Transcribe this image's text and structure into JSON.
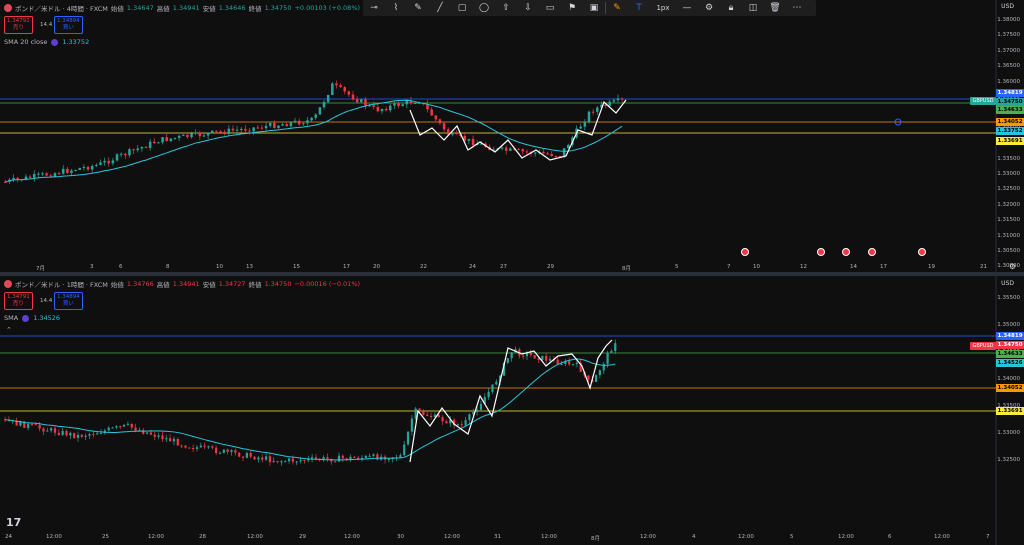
{
  "toolbar": {
    "icons": [
      "horizontal-ray-icon",
      "path-icon",
      "pen-icon",
      "line-icon",
      "rectangle-icon",
      "circle-icon",
      "arrow-up-icon",
      "arrow-down-icon",
      "note-icon",
      "flag-icon",
      "image-icon",
      "palette-icon",
      "text-color-icon",
      "line-width-icon",
      "line-style-icon",
      "settings-icon",
      "lock-icon",
      "hide-icon",
      "trash-icon",
      "more-icon"
    ],
    "width_label": "1px"
  },
  "pane1": {
    "title": "ポンド／米ドル · 4時間 · FXCM",
    "open_label": "始値",
    "open": "1.34647",
    "high_label": "高値",
    "high": "1.34941",
    "low_label": "安値",
    "low": "1.34646",
    "close_label": "終値",
    "close": "1.34750",
    "change": "+0.00103 (+0.08%)",
    "sell_price": "1.34791",
    "sell_label": "売り",
    "buy_price": "1.34894",
    "buy_label": "買い",
    "spread": "14.4",
    "sma_label": "SMA 20 close",
    "sma_value": "1.33752",
    "currency": "USD",
    "y_ticks": [
      "1.38000",
      "1.37500",
      "1.37000",
      "1.36500",
      "1.36000",
      "1.35500",
      "1.35000",
      "1.34500",
      "1.34000",
      "1.33500",
      "1.33000",
      "1.32500",
      "1.32000",
      "1.31500",
      "1.31000",
      "1.30500",
      "1.30000",
      "1.29500"
    ],
    "price_tags": [
      {
        "text": "1.34819",
        "color": "#2962ff"
      },
      {
        "text": "1.34750",
        "color": "#26a69a"
      },
      {
        "text": "1.34633",
        "color": "#4caf50"
      },
      {
        "text": "1.34052",
        "color": "#ff9800"
      },
      {
        "text": "1.33752",
        "color": "#26c6da"
      },
      {
        "text": "1.33691",
        "color": "#ffeb3b"
      }
    ],
    "pair_tag": "GBPUSD",
    "x_labels": [
      "7月",
      "3",
      "6",
      "8",
      "10",
      "13",
      "15",
      "17",
      "20",
      "22",
      "24",
      "27",
      "29",
      "8月",
      "5",
      "7",
      "10",
      "12",
      "14",
      "17",
      "19",
      "21"
    ]
  },
  "pane2": {
    "title": "ポンド／米ドル · 1時間 · FXCM",
    "open_label": "始値",
    "open": "1.34766",
    "high_label": "高値",
    "high": "1.34941",
    "low_label": "安値",
    "low": "1.34727",
    "close_label": "終値",
    "close": "1.34750",
    "change": "−0.00016 (−0.01%)",
    "sell_price": "1.34791",
    "sell_label": "売り",
    "buy_price": "1.34894",
    "buy_label": "買い",
    "spread": "14.4",
    "sma_label": "SMA",
    "sma_value": "1.34526",
    "currency": "USD",
    "y_ticks": [
      "1.35500",
      "1.35000",
      "1.34500",
      "1.34000",
      "1.33500",
      "1.33000",
      "1.32500"
    ],
    "price_tags": [
      {
        "text": "1.34819",
        "color": "#2962ff"
      },
      {
        "text": "1.34750",
        "color": "#f23645"
      },
      {
        "text": "1.34633",
        "color": "#4caf50"
      },
      {
        "text": "1.34526",
        "color": "#26c6da"
      },
      {
        "text": "1.34052",
        "color": "#ff9800"
      },
      {
        "text": "1.33691",
        "color": "#ffeb3b"
      }
    ],
    "pair_tag": "GBPUSD",
    "x_labels": [
      "24",
      "12:00",
      "25",
      "12:00",
      "28",
      "12:00",
      "29",
      "12:00",
      "30",
      "12:00",
      "31",
      "12:00",
      "8月",
      "12:00",
      "4",
      "12:00",
      "5",
      "12:00",
      "6",
      "12:00",
      "7"
    ]
  },
  "colors": {
    "up": "#26a69a",
    "down": "#f23645",
    "sma": "#26c6da",
    "zigzag": "#ffffff",
    "bg": "#0f0f0f"
  }
}
